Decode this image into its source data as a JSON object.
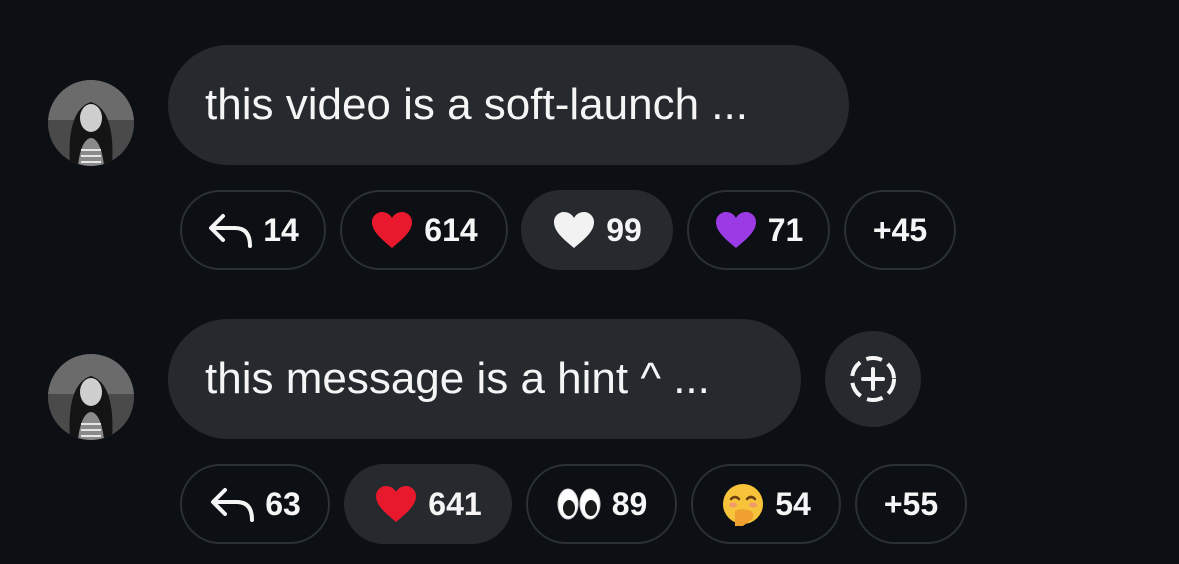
{
  "messages": [
    {
      "text": "this video is a soft-launch ...",
      "reactions": {
        "reply": {
          "icon": "reply-arrow-icon",
          "count": "14"
        },
        "items": [
          {
            "icon": "red-heart-icon",
            "count": "614",
            "selected": false
          },
          {
            "icon": "white-heart-icon",
            "count": "99",
            "selected": true
          },
          {
            "icon": "purple-heart-icon",
            "count": "71",
            "selected": false
          }
        ],
        "more": "+45"
      }
    },
    {
      "text": "this message is a hint ^ ...",
      "add_reaction_icon": "dashed-circle-plus-icon",
      "reactions": {
        "reply": {
          "icon": "reply-arrow-icon",
          "count": "63"
        },
        "items": [
          {
            "icon": "red-heart-icon",
            "count": "641",
            "selected": true
          },
          {
            "icon": "eyes-icon",
            "count": "89",
            "selected": false
          },
          {
            "icon": "face-with-hand-over-mouth-icon",
            "count": "54",
            "selected": false
          }
        ],
        "more": "+55"
      }
    }
  ],
  "colors": {
    "background": "#0c1014",
    "bubble": "#262a2f",
    "pill_border": "#2b3036",
    "text": "#f5f5f5",
    "red_heart": "#e8192c",
    "purple_heart": "#9b3be6",
    "white_heart": "#f2f2f2"
  }
}
